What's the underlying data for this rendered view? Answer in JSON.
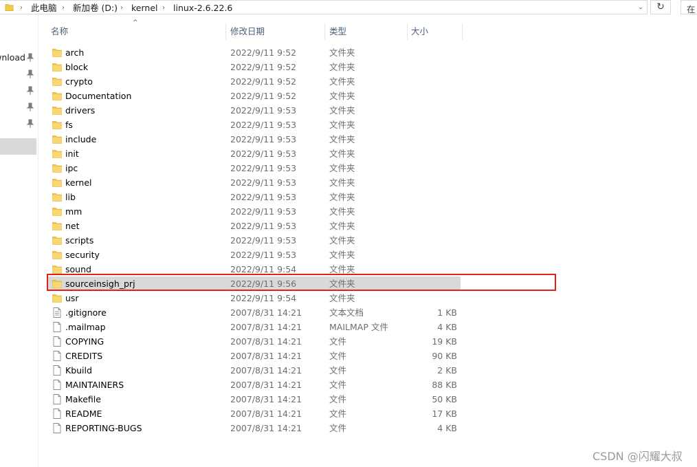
{
  "address": {
    "crumbs": [
      "此电脑",
      "新加卷 (D:)",
      "kernel",
      "linux-2.6.22.6"
    ],
    "separator": "›",
    "dropdown_glyph": "⌄",
    "refresh_glyph": "↻",
    "search_text": "在"
  },
  "nav": {
    "items": [
      {
        "label": "wnload",
        "pinned": true
      },
      {
        "label": "",
        "pinned": true
      },
      {
        "label": "",
        "pinned": true
      },
      {
        "label": "",
        "pinned": true
      },
      {
        "label": "",
        "pinned": true
      }
    ]
  },
  "columns": {
    "name": "名称",
    "modified": "修改日期",
    "type": "类型",
    "size": "大小",
    "sort_glyph": "^"
  },
  "files": [
    {
      "name": "arch",
      "date": "2022/9/11 9:52",
      "type": "文件夹",
      "size": "",
      "kind": "folder"
    },
    {
      "name": "block",
      "date": "2022/9/11 9:52",
      "type": "文件夹",
      "size": "",
      "kind": "folder"
    },
    {
      "name": "crypto",
      "date": "2022/9/11 9:52",
      "type": "文件夹",
      "size": "",
      "kind": "folder"
    },
    {
      "name": "Documentation",
      "date": "2022/9/11 9:52",
      "type": "文件夹",
      "size": "",
      "kind": "folder"
    },
    {
      "name": "drivers",
      "date": "2022/9/11 9:53",
      "type": "文件夹",
      "size": "",
      "kind": "folder"
    },
    {
      "name": "fs",
      "date": "2022/9/11 9:53",
      "type": "文件夹",
      "size": "",
      "kind": "folder"
    },
    {
      "name": "include",
      "date": "2022/9/11 9:53",
      "type": "文件夹",
      "size": "",
      "kind": "folder"
    },
    {
      "name": "init",
      "date": "2022/9/11 9:53",
      "type": "文件夹",
      "size": "",
      "kind": "folder"
    },
    {
      "name": "ipc",
      "date": "2022/9/11 9:53",
      "type": "文件夹",
      "size": "",
      "kind": "folder"
    },
    {
      "name": "kernel",
      "date": "2022/9/11 9:53",
      "type": "文件夹",
      "size": "",
      "kind": "folder"
    },
    {
      "name": "lib",
      "date": "2022/9/11 9:53",
      "type": "文件夹",
      "size": "",
      "kind": "folder"
    },
    {
      "name": "mm",
      "date": "2022/9/11 9:53",
      "type": "文件夹",
      "size": "",
      "kind": "folder"
    },
    {
      "name": "net",
      "date": "2022/9/11 9:53",
      "type": "文件夹",
      "size": "",
      "kind": "folder"
    },
    {
      "name": "scripts",
      "date": "2022/9/11 9:53",
      "type": "文件夹",
      "size": "",
      "kind": "folder"
    },
    {
      "name": "security",
      "date": "2022/9/11 9:53",
      "type": "文件夹",
      "size": "",
      "kind": "folder"
    },
    {
      "name": "sound",
      "date": "2022/9/11 9:54",
      "type": "文件夹",
      "size": "",
      "kind": "folder"
    },
    {
      "name": "sourceinsigh_prj",
      "date": "2022/9/11 9:56",
      "type": "文件夹",
      "size": "",
      "kind": "folder",
      "selected": true
    },
    {
      "name": "usr",
      "date": "2022/9/11 9:54",
      "type": "文件夹",
      "size": "",
      "kind": "folder"
    },
    {
      "name": ".gitignore",
      "date": "2007/8/31 14:21",
      "type": "文本文档",
      "size": "1 KB",
      "kind": "text"
    },
    {
      "name": ".mailmap",
      "date": "2007/8/31 14:21",
      "type": "MAILMAP 文件",
      "size": "4 KB",
      "kind": "file"
    },
    {
      "name": "COPYING",
      "date": "2007/8/31 14:21",
      "type": "文件",
      "size": "19 KB",
      "kind": "file"
    },
    {
      "name": "CREDITS",
      "date": "2007/8/31 14:21",
      "type": "文件",
      "size": "90 KB",
      "kind": "file"
    },
    {
      "name": "Kbuild",
      "date": "2007/8/31 14:21",
      "type": "文件",
      "size": "2 KB",
      "kind": "file"
    },
    {
      "name": "MAINTAINERS",
      "date": "2007/8/31 14:21",
      "type": "文件",
      "size": "88 KB",
      "kind": "file"
    },
    {
      "name": "Makefile",
      "date": "2007/8/31 14:21",
      "type": "文件",
      "size": "50 KB",
      "kind": "file"
    },
    {
      "name": "README",
      "date": "2007/8/31 14:21",
      "type": "文件",
      "size": "17 KB",
      "kind": "file"
    },
    {
      "name": "REPORTING-BUGS",
      "date": "2007/8/31 14:21",
      "type": "文件",
      "size": "4 KB",
      "kind": "file"
    }
  ],
  "watermark": "CSDN @闪耀大叔",
  "colors": {
    "highlight_box": "#e0201b",
    "selected_row": "#d9d9d9",
    "folder": "#f3c94c",
    "header_text": "#4c607a"
  },
  "icons": {
    "folder": "folder-icon",
    "file": "file-icon",
    "text": "text-file-icon",
    "pin": "pin-icon"
  }
}
